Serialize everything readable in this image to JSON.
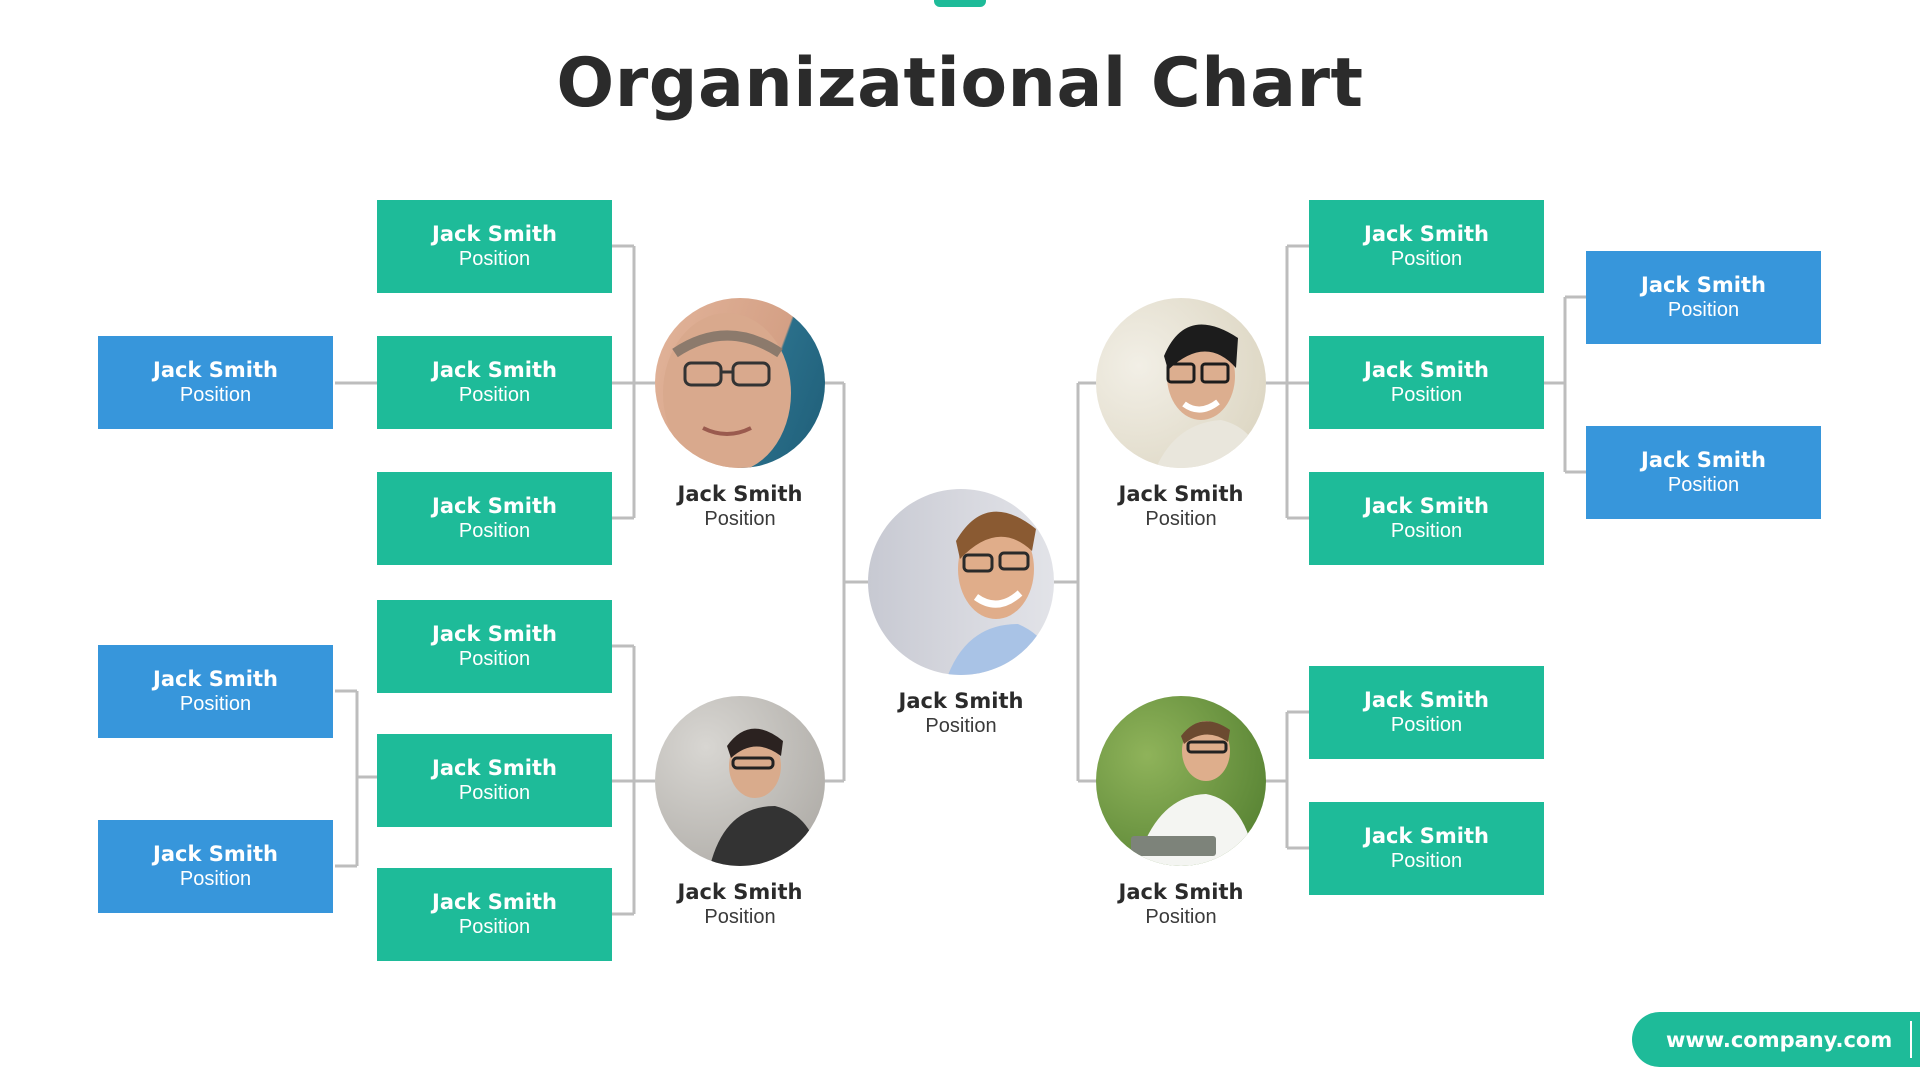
{
  "title": "Organizational Chart",
  "colors": {
    "green": "#1ebb99",
    "blue": "#3796db",
    "connector": "#bdbdbd",
    "text_dark": "#2b2b2b"
  },
  "ceo": {
    "name": "Jack Smith",
    "position": "Position",
    "photo_icon": "person-photo"
  },
  "managers": [
    {
      "id": "left-top",
      "name": "Jack Smith",
      "position": "Position",
      "photo_icon": "person-photo"
    },
    {
      "id": "left-bottom",
      "name": "Jack Smith",
      "position": "Position",
      "photo_icon": "person-photo"
    },
    {
      "id": "right-top",
      "name": "Jack Smith",
      "position": "Position",
      "photo_icon": "person-photo"
    },
    {
      "id": "right-bottom",
      "name": "Jack Smith",
      "position": "Position",
      "photo_icon": "person-photo"
    }
  ],
  "left_top_team": [
    {
      "name": "Jack Smith",
      "position": "Position"
    },
    {
      "name": "Jack Smith",
      "position": "Position"
    },
    {
      "name": "Jack Smith",
      "position": "Position"
    }
  ],
  "left_top_sub": [
    {
      "name": "Jack Smith",
      "position": "Position"
    }
  ],
  "left_bottom_team": [
    {
      "name": "Jack Smith",
      "position": "Position"
    },
    {
      "name": "Jack Smith",
      "position": "Position"
    },
    {
      "name": "Jack Smith",
      "position": "Position"
    }
  ],
  "left_bottom_sub": [
    {
      "name": "Jack Smith",
      "position": "Position"
    },
    {
      "name": "Jack Smith",
      "position": "Position"
    }
  ],
  "right_top_team": [
    {
      "name": "Jack Smith",
      "position": "Position"
    },
    {
      "name": "Jack Smith",
      "position": "Position"
    },
    {
      "name": "Jack Smith",
      "position": "Position"
    }
  ],
  "right_top_sub": [
    {
      "name": "Jack Smith",
      "position": "Position"
    },
    {
      "name": "Jack Smith",
      "position": "Position"
    }
  ],
  "right_bottom_team": [
    {
      "name": "Jack Smith",
      "position": "Position"
    },
    {
      "name": "Jack Smith",
      "position": "Position"
    }
  ],
  "footer": {
    "url": "www.company.com"
  }
}
